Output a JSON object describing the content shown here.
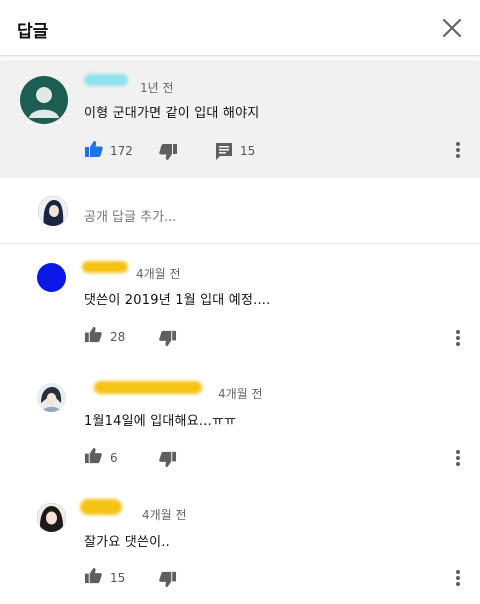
{
  "header": {
    "title": "답글"
  },
  "top_comment": {
    "time": "1년 전",
    "text": "이형 군대가면 같이 입대 해야지",
    "likes": "172",
    "replies": "15",
    "blur_color": "#8fe3ef"
  },
  "add_reply": {
    "placeholder": "공개 답글 추가..."
  },
  "replies": [
    {
      "time": "4개월 전",
      "text": "댓쓴이 2019년 1월 입대 예정....",
      "likes": "28",
      "blur_color": "#f5c314",
      "avatar_color": "#0a17e6"
    },
    {
      "time": "4개월 전",
      "text": "1월14일에 입대해요...ㅠㅠ",
      "likes": "6",
      "blur_color": "#f5c314"
    },
    {
      "time": "4개월 전",
      "text": "잘가요 댓쓴이..",
      "likes": "15",
      "blur_color": "#f5c314"
    }
  ],
  "colors": {
    "like_active": "#1a73e8",
    "icon_gray": "#5f5f5f"
  }
}
